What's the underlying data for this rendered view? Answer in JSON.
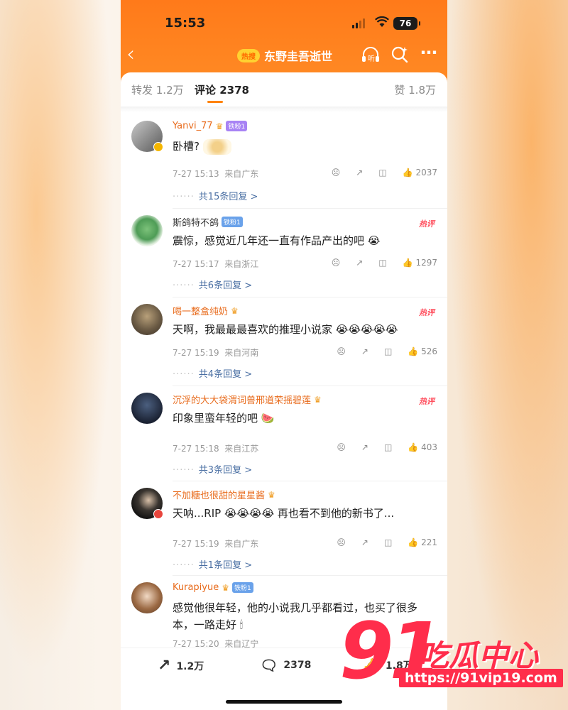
{
  "status": {
    "time": "15:53",
    "battery": "76"
  },
  "nav": {
    "hot_tag": "热搜",
    "title": "东野圭吾逝世",
    "listen": "听"
  },
  "tabs": {
    "repost": "转发 1.2万",
    "comments": "评论 2378",
    "likes": "赞 1.8万"
  },
  "comments": [
    {
      "user": "Yanvi_77",
      "fan": "铁粉1",
      "text": "卧槽?",
      "time": "7-27 15:13",
      "loc": "来自广东",
      "likes": "2037",
      "replies": "共15条回复 >",
      "hot": ""
    },
    {
      "user": "斯鸽特不鸽",
      "fan": "铁粉1",
      "text": "震惊，感觉近几年还一直有作品产出的吧",
      "time": "7-27 15:17",
      "loc": "来自浙江",
      "likes": "1297",
      "replies": "共6条回复 >",
      "hot": "热评"
    },
    {
      "user": "喝一整盒纯奶",
      "fan": "",
      "text": "天啊，我最最最喜欢的推理小说家",
      "time": "7-27 15:19",
      "loc": "来自河南",
      "likes": "526",
      "replies": "共4条回复 >",
      "hot": "热评"
    },
    {
      "user": "沉浮的大大袋渭词兽邢道荣摇碧莲",
      "fan": "",
      "text": "印象里蛮年轻的吧",
      "time": "7-27 15:18",
      "loc": "来自江苏",
      "likes": "403",
      "replies": "共3条回复 >",
      "hot": "热评"
    },
    {
      "user": "不加糖也很甜的星星酱",
      "fan": "",
      "text": "天呐...RIP",
      "text2": "再也看不到他的新书了...",
      "time": "7-27 15:19",
      "loc": "来自广东",
      "likes": "221",
      "replies": "共1条回复 >",
      "hot": ""
    },
    {
      "user": "Kurapiyue",
      "fan": "铁粉1",
      "text": "感觉他很年轻，他的小说我几乎都看过，也买了很多本，一路走好",
      "time": "7-27 15:20",
      "loc": "来自辽宁",
      "likes": "",
      "replies": "",
      "hot": ""
    }
  ],
  "bottom": {
    "repost": "1.2万",
    "comment": "2378",
    "like": "1.8万"
  },
  "watermark": {
    "num": "91",
    "name": "吃瓜中心",
    "url": "https://91vip19.com"
  },
  "colors": {
    "accent": "#ff8200",
    "username": "#e86b1c",
    "hot": "#ff4f5e",
    "watermark": "#ff2d4b"
  }
}
